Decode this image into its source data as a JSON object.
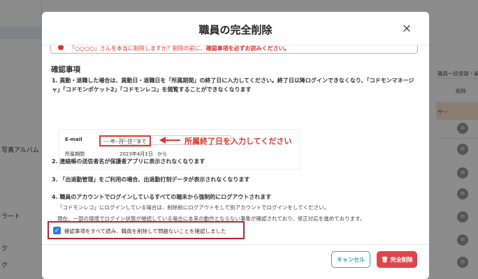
{
  "background": {
    "left_items": [
      "",
      "",
      "",
      "",
      "",
      "",
      "",
      "",
      "",
      ""
    ],
    "left_texts": [
      "",
      "",
      "",
      "",
      "",
      "",
      "",
      "",
      "",
      ""
    ],
    "left_visible": [
      "写真アルバム",
      "ラート",
      "ク",
      "ク"
    ],
    "right_header": "職員一括登録・編集（CS",
    "right_col": "削除",
    "right_tag": "ザー",
    "right_circle": "☰"
  },
  "modal": {
    "title": "職員の完全削除",
    "close_icon": "×",
    "alert_text": "「○○○○」さんを本当に削除しますか？削除の前に、",
    "alert_bold": "確認事項を必ずお読みください。",
    "section_title": "確認事項",
    "items": [
      {
        "title": "1. 異動・退職した場合は、異動日・退職日を「所属期間」の終了日に入力してください。終了日以降ログインできなくなり、「コドモンマネージャ」「コドモンポケット2」「コドモンレコ」を閲覧することができなくなります"
      },
      {
        "title": "2. 連絡帳の送信者名が保護者アプリに表示されなくなります"
      },
      {
        "title": "3. 「出退勤管理」をご利用の場合、出退勤打刻データが表示されなくなります"
      },
      {
        "title": "4. 職員のアカウントでログインしているすべての端末から強制的にログアウトされます",
        "sub1": "「コドモンレコ」にログインしている場合は、削除前にログアウトをして別アカウントでログインをしてください。",
        "sub2": "現在、一部の環境でログイン状態が継続している場合に本来の動作とならない事象が確認されており、修正対応を進めております。"
      }
    ],
    "example": {
      "email_label": "E-mail",
      "email_placeholder": "E-mail",
      "period_label": "所属期間",
      "start_date": "2023年4月1日",
      "from_text": "から",
      "end_date_placeholder": "----年--月--日",
      "until_text": "まで",
      "note": "所属終了日を入力してください"
    },
    "confirm_label": "確認事項をすべて読み、職員を削除して問題ないことを確認しました",
    "checkbox_checked": true,
    "cancel_label": "キャンセル",
    "delete_label": "完全削除"
  },
  "colors": {
    "accent": "#2fa5b7",
    "danger": "#e0454c",
    "highlight_red": "#e0352b"
  }
}
